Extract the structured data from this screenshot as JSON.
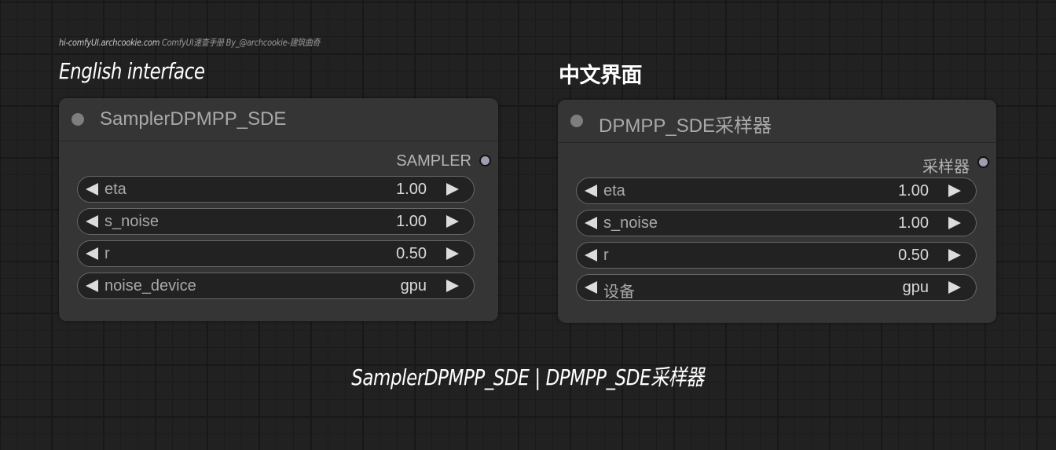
{
  "credit": {
    "site": "hi-comfyUI.archcookie.com",
    "text": " ComfyUI速查手册  By_@archcookie-建筑曲奇"
  },
  "headings": {
    "english": "English interface",
    "chinese": "中文界面"
  },
  "nodes": [
    {
      "title": "SamplerDPMPP_SDE",
      "output": {
        "label": "SAMPLER",
        "color": "#9e9eb0"
      },
      "widgets": [
        {
          "label": "eta",
          "value": "1.00"
        },
        {
          "label": "s_noise",
          "value": "1.00"
        },
        {
          "label": "r",
          "value": "0.50"
        },
        {
          "label": "noise_device",
          "value": "gpu"
        }
      ]
    },
    {
      "title": "DPMPP_SDE采样器",
      "output": {
        "label": "采样器",
        "color": "#9e9eb0"
      },
      "widgets": [
        {
          "label": "eta",
          "value": "1.00"
        },
        {
          "label": "s_noise",
          "value": "1.00"
        },
        {
          "label": "r",
          "value": "0.50"
        },
        {
          "label": "设备",
          "value": "gpu"
        }
      ]
    }
  ],
  "caption": "SamplerDPMPP_SDE | DPMPP_SDE采样器",
  "icons": {
    "node_status": "circle-dot-icon",
    "decrement": "triangle-left-icon",
    "increment": "triangle-right-icon",
    "output_slot": "output-slot-icon"
  }
}
